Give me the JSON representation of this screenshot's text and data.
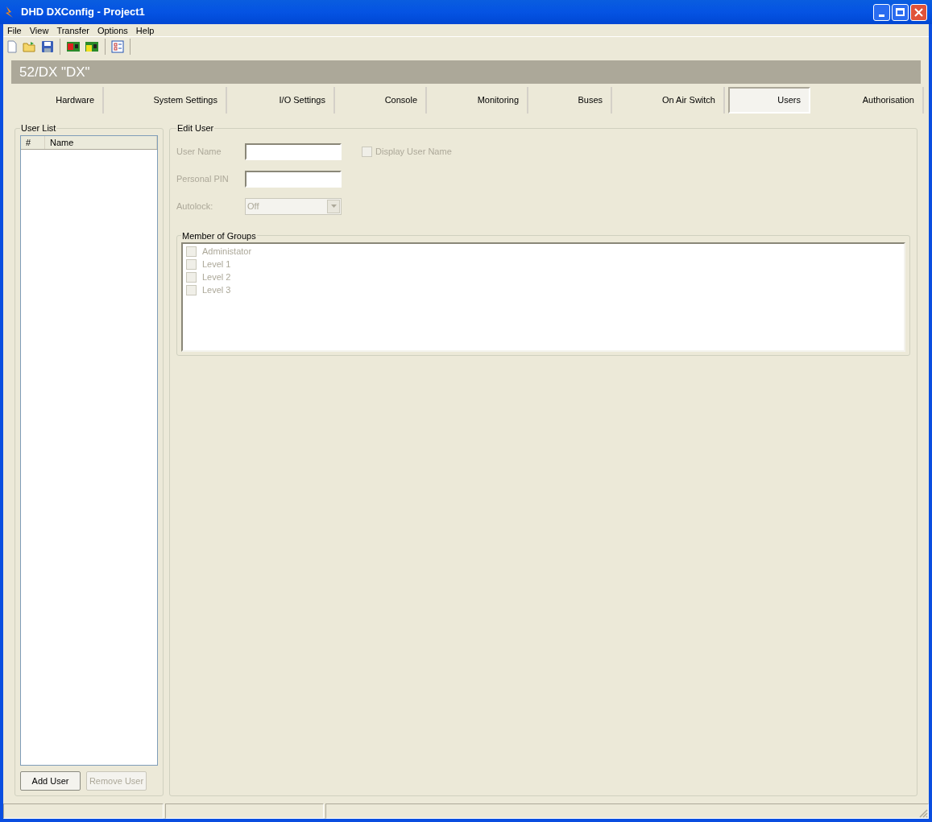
{
  "window": {
    "title": "DHD DXConfig - Project1"
  },
  "menu": [
    {
      "label": "File"
    },
    {
      "label": "View"
    },
    {
      "label": "Transfer"
    },
    {
      "label": "Options"
    },
    {
      "label": "Help"
    }
  ],
  "header": {
    "title": "52/DX \"DX\""
  },
  "tabs": [
    {
      "label": "Hardware",
      "selected": false
    },
    {
      "label": "System Settings",
      "selected": false
    },
    {
      "label": "I/O Settings",
      "selected": false
    },
    {
      "label": "Console",
      "selected": false
    },
    {
      "label": "Monitoring",
      "selected": false
    },
    {
      "label": "Buses",
      "selected": false
    },
    {
      "label": "On Air Switch",
      "selected": false
    },
    {
      "label": "Users",
      "selected": true
    },
    {
      "label": "Authorisation",
      "selected": false
    }
  ],
  "user_list": {
    "title": "User List",
    "columns": [
      "#",
      "Name"
    ],
    "buttons": [
      {
        "label": "Add User",
        "disabled": false
      },
      {
        "label": "Remove User",
        "disabled": true
      }
    ]
  },
  "edit_user": {
    "title": "Edit User",
    "fields": [
      {
        "label": "User Name",
        "kind": "text",
        "disabled": true
      },
      {
        "label": "Personal PIN",
        "kind": "text",
        "disabled": true
      },
      {
        "label": "Autolock:",
        "kind": "select",
        "value": "Off",
        "disabled": true
      }
    ],
    "display_user_name": {
      "label": "Display User Name",
      "checked": false,
      "disabled": true
    },
    "groups": {
      "title": "Member of Groups",
      "items": [
        {
          "label": "Administator",
          "checked": false,
          "disabled": true
        },
        {
          "label": "Level 1",
          "checked": false,
          "disabled": true
        },
        {
          "label": "Level 2",
          "checked": false,
          "disabled": true
        },
        {
          "label": "Level 3",
          "checked": false,
          "disabled": true
        }
      ]
    }
  }
}
